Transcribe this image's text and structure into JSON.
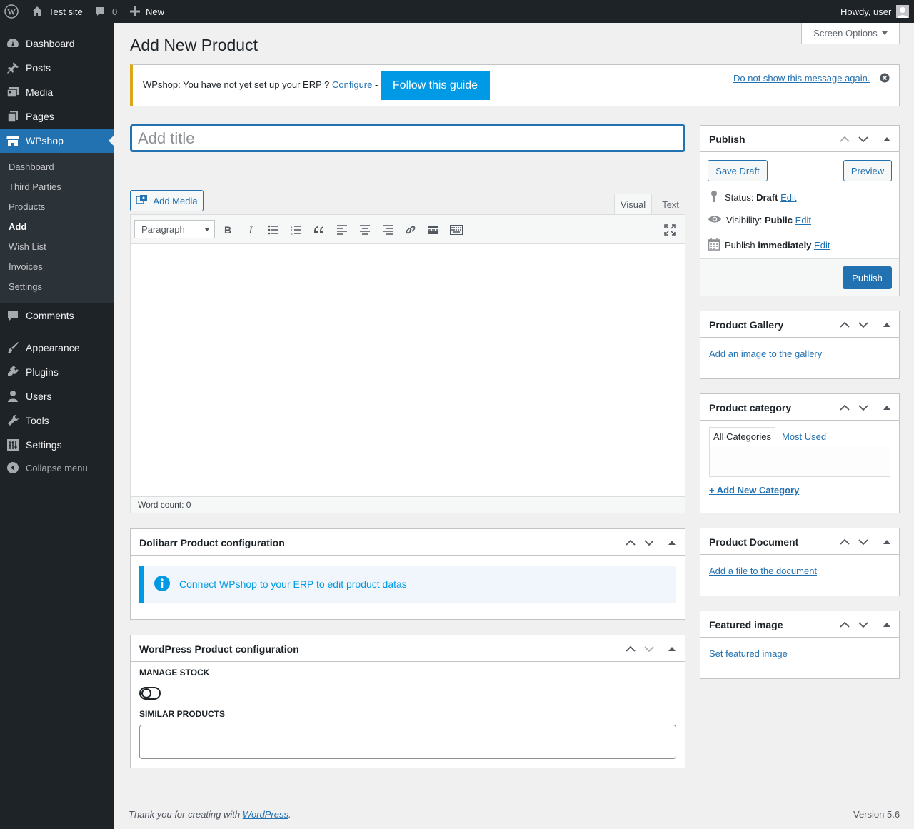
{
  "adminbar": {
    "site_name": "Test site",
    "comments_count": "0",
    "new_label": "New",
    "howdy": "Howdy, user"
  },
  "sidebar": {
    "items": [
      {
        "label": "Dashboard",
        "icon": "dashboard-icon"
      },
      {
        "label": "Posts",
        "icon": "pin-icon"
      },
      {
        "label": "Media",
        "icon": "media-icon"
      },
      {
        "label": "Pages",
        "icon": "pages-icon"
      },
      {
        "label": "WPshop",
        "icon": "store-icon"
      },
      {
        "label": "Comments",
        "icon": "comment-icon"
      },
      {
        "label": "Appearance",
        "icon": "brush-icon"
      },
      {
        "label": "Plugins",
        "icon": "plug-icon"
      },
      {
        "label": "Users",
        "icon": "user-icon"
      },
      {
        "label": "Tools",
        "icon": "wrench-icon"
      },
      {
        "label": "Settings",
        "icon": "sliders-icon"
      },
      {
        "label": "Collapse menu",
        "icon": "collapse-icon"
      }
    ],
    "submenu": [
      "Dashboard",
      "Third Parties",
      "Products",
      "Add",
      "Wish List",
      "Invoices",
      "Settings"
    ]
  },
  "page": {
    "title": "Add New Product",
    "screen_options": "Screen Options"
  },
  "notice": {
    "text": "WPshop: You have not yet set up your ERP ?",
    "configure": "Configure",
    "dash": "-",
    "guide_button": "Follow this guide",
    "dismiss": "Do not show this message again."
  },
  "editor": {
    "title_placeholder": "Add title",
    "add_media": "Add Media",
    "tab_visual": "Visual",
    "tab_text": "Text",
    "format_select": "Paragraph",
    "word_count": "Word count: 0"
  },
  "dolibarr_box": {
    "title": "Dolibarr Product configuration",
    "info": "Connect WPshop to your ERP to edit product datas"
  },
  "wp_box": {
    "title": "WordPress Product configuration",
    "manage_stock": "MANAGE STOCK",
    "similar_products": "SIMILAR PRODUCTS",
    "manage_stock_enabled": false
  },
  "publish": {
    "title": "Publish",
    "save_draft": "Save Draft",
    "preview": "Preview",
    "status_label": "Status:",
    "status_value": "Draft",
    "visibility_label": "Visibility:",
    "visibility_value": "Public",
    "publish_label": "Publish",
    "publish_value": "immediately",
    "edit": "Edit",
    "publish_button": "Publish"
  },
  "gallery": {
    "title": "Product Gallery",
    "link": "Add an image to the gallery"
  },
  "category": {
    "title": "Product category",
    "tab_all": "All Categories",
    "tab_most": "Most Used",
    "add_new": "+ Add New Category"
  },
  "document": {
    "title": "Product Document",
    "link": "Add a file to the document"
  },
  "featured": {
    "title": "Featured image",
    "link": "Set featured image"
  },
  "footer": {
    "thanks_prefix": "Thank you for creating with",
    "wordpress": "WordPress",
    "thanks_suffix": ".",
    "version": "Version 5.6"
  },
  "colors": {
    "accent": "#2271b1",
    "sidebar_bg": "#1d2327",
    "active_menu": "#2271b1",
    "notice_border": "#dba617",
    "guide_button": "#0099e5"
  }
}
